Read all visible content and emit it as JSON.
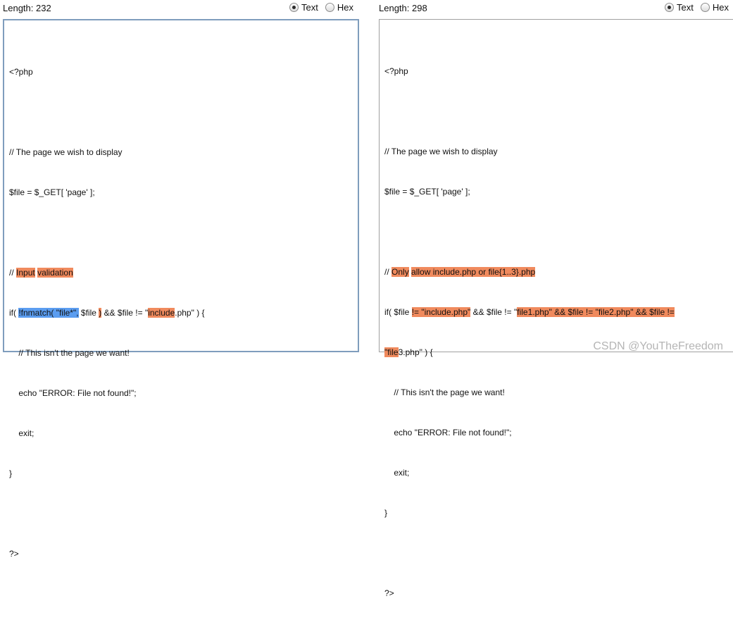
{
  "left_pane": {
    "length_label": "Length: 232",
    "options": {
      "text": "Text",
      "hex": "Hex",
      "selected": "text"
    },
    "code": {
      "l1": "<?php",
      "l3": "// The page we wish to display",
      "l4": "$file = $_GET[ 'page' ];",
      "l6a": "// ",
      "l6b": "Input",
      "l6c": " ",
      "l6d": "validation",
      "l7a": "if( ",
      "l7b": "!fnmatch( \"file*\",",
      "l7c": " $file ",
      "l7d": ")",
      "l7e": " && $file != \"",
      "l7f": "include",
      "l7g": ".php\" ) {",
      "l8": "    // This isn't the page we want!",
      "l9": "    echo \"ERROR: File not found!\";",
      "l10": "    exit;",
      "l11": "}",
      "l13": "?>"
    }
  },
  "right_pane": {
    "length_label": "Length: 298",
    "options": {
      "text": "Text",
      "hex": "Hex",
      "selected": "text"
    },
    "code": {
      "l1": "<?php",
      "l3": "// The page we wish to display",
      "l4": "$file = $_GET[ 'page' ];",
      "l6a": "// ",
      "l6b": "Only",
      "l6c": " ",
      "l6d": "allow include.php or file{1..3}.php",
      "l7a": "if( $file ",
      "l7b": "!= \"include.php\"",
      "l7c": " && $file != \"",
      "l7d": "file1.php\" && $file != \"file2.php\" && $file !=",
      "l8a": "\"file",
      "l8b": "3.php\" ) {",
      "l9": "    // This isn't the page we want!",
      "l10": "    echo \"ERROR: File not found!\";",
      "l11": "    exit;",
      "l12": "}",
      "l14": "?>"
    }
  },
  "watermark": "CSDN @YouTheFreedom"
}
